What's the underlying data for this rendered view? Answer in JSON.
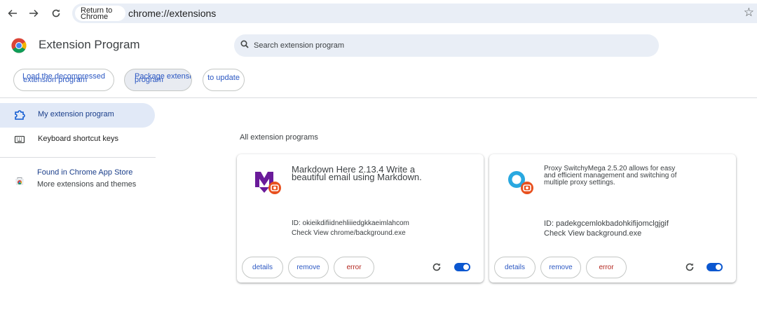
{
  "browser": {
    "back_icon": "arrow-left-icon",
    "forward_icon": "arrow-right-icon",
    "reload_icon": "reload-icon",
    "chip_line1": "Return to",
    "chip_line2": "Chrome",
    "url": "chrome://extensions",
    "bookmark_icon": "star-icon"
  },
  "header": {
    "title": "Extension Program",
    "search_placeholder": "Search extension program",
    "buttons": {
      "load_l1": "Load the decompressed",
      "load_l2": "extension program",
      "package_l1": "Package extension",
      "package_l2": "program",
      "update": "to update"
    }
  },
  "sidebar": {
    "items": [
      {
        "label": "My extension program",
        "icon": "puzzle-icon",
        "selected": true
      },
      {
        "label": "Keyboard shortcut keys",
        "icon": "keyboard-icon",
        "selected": false
      }
    ],
    "store_line1": "Found in Chrome App Store",
    "store_line2": "More extensions and themes"
  },
  "main": {
    "section_title": "All extension programs",
    "extensions": [
      {
        "title": "Markdown Here 2.13.4 Write a beautiful email using Markdown.",
        "id_line": "ID: okieikdifiidnehliiiedgkkaeimlahcom",
        "view_line": "Check View chrome/background.exe",
        "details": "details",
        "remove": "remove",
        "error": "error",
        "enabled": true
      },
      {
        "title": "Proxy SwitchyMega 2.5.20 allows for easy and efficient management and switching of multiple proxy settings.",
        "id_line": "ID: padekgcemlokbadohkifijomclgjgif",
        "view_line": "Check View background.exe",
        "details": "details",
        "remove": "remove",
        "error": "error",
        "enabled": true
      }
    ]
  },
  "colors": {
    "accent": "#0b57d0",
    "link": "#2b57c2",
    "error": "#b3261e",
    "selected_bg": "#e1e9f7",
    "omnibox_bg": "#e9eef6"
  }
}
